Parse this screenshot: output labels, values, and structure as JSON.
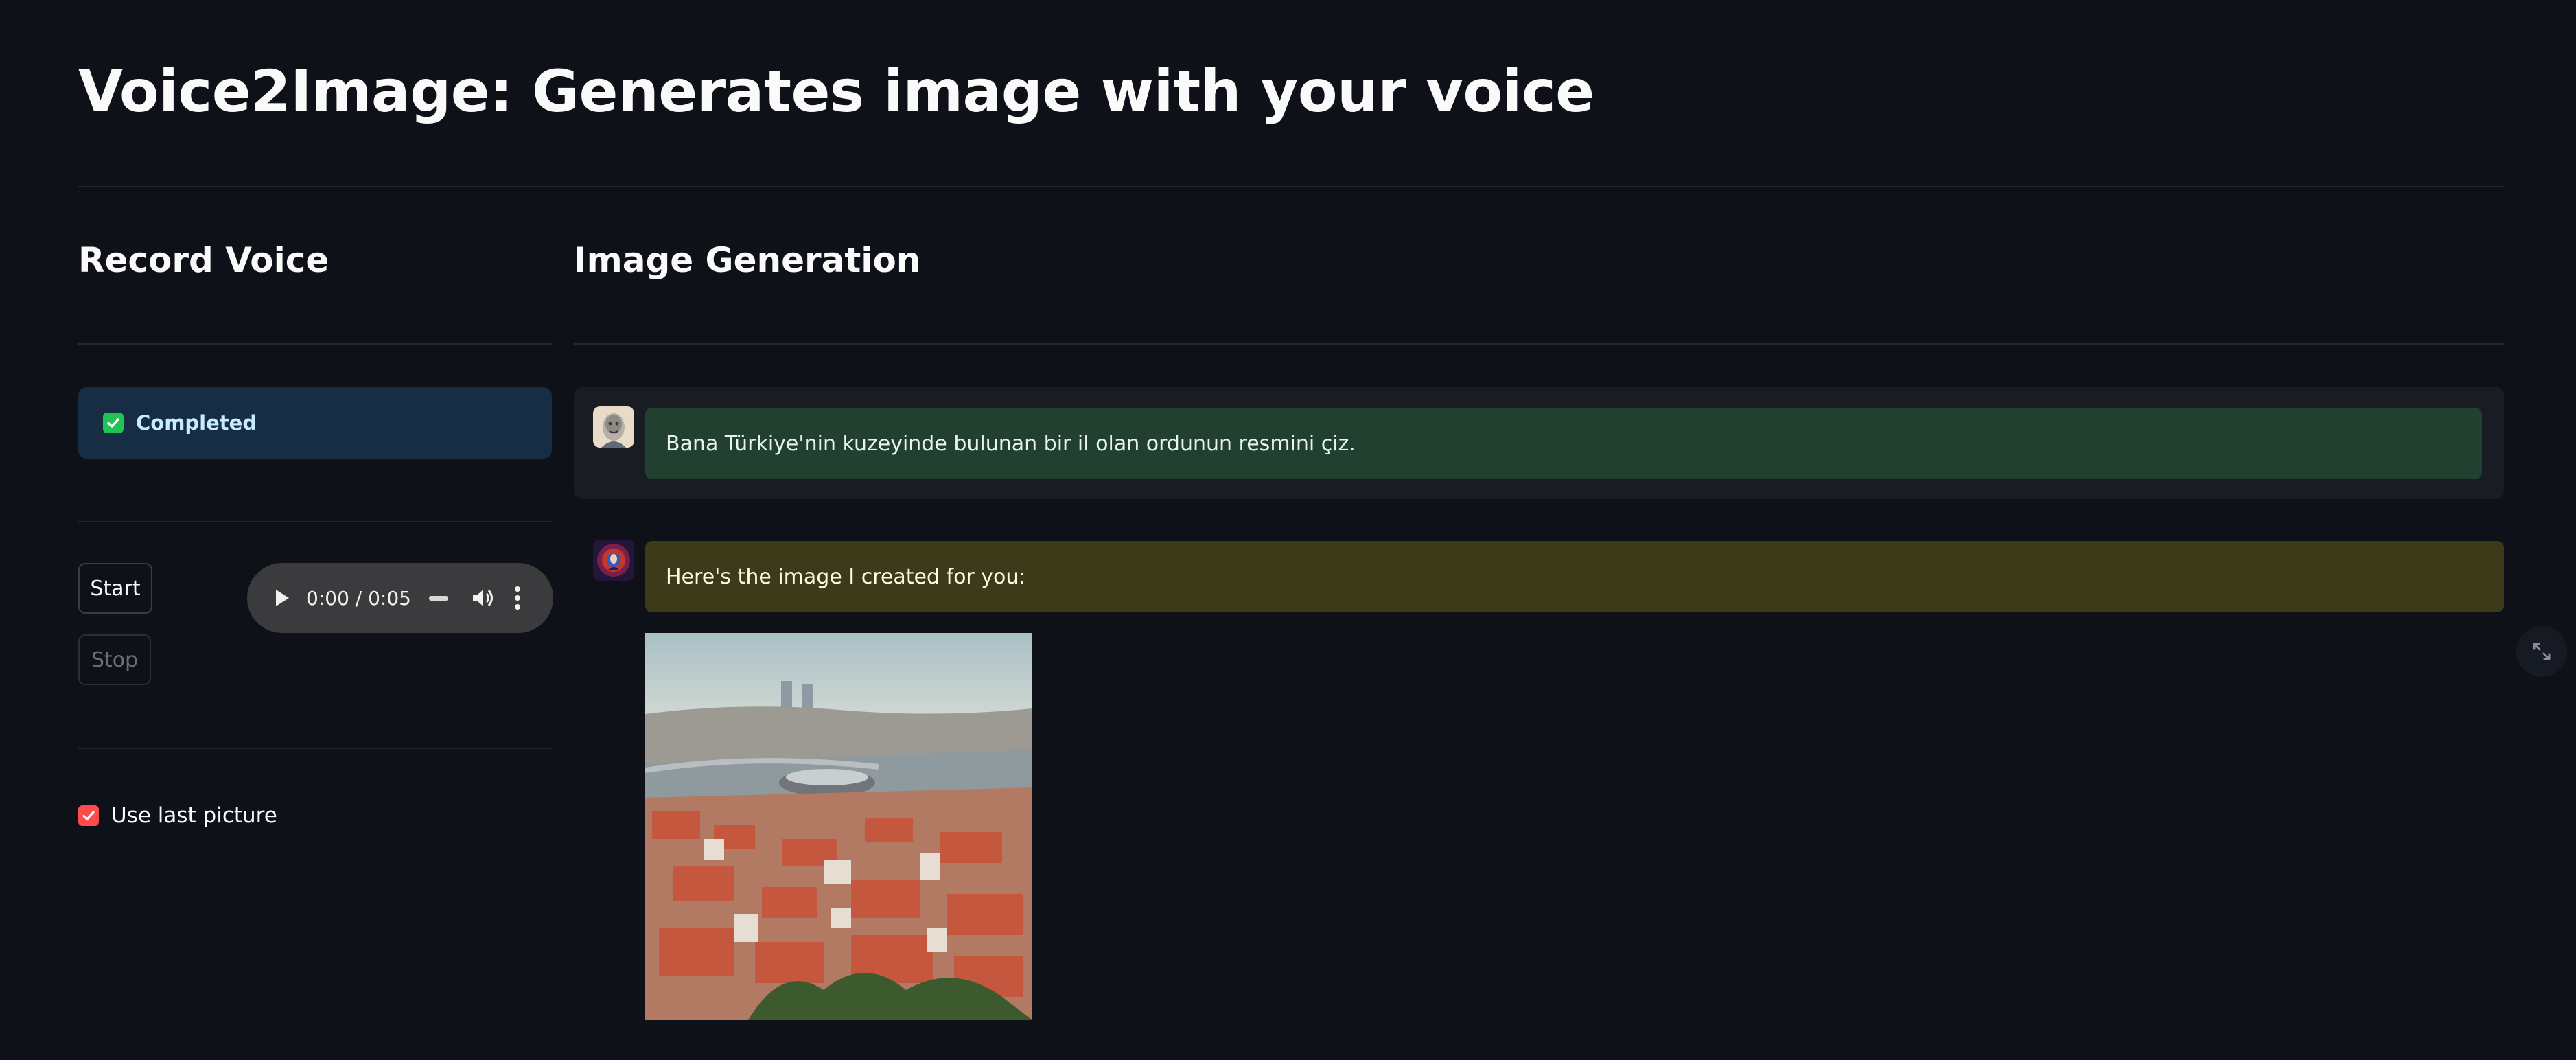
{
  "page": {
    "title": "Voice2Image: Generates image with your voice"
  },
  "left": {
    "heading": "Record Voice",
    "status": {
      "text": "Completed"
    },
    "buttons": {
      "start": "Start",
      "stop": "Stop"
    },
    "audio": {
      "time": "0:00 / 0:05"
    },
    "use_last": {
      "label": "Use last picture",
      "checked": true
    }
  },
  "right": {
    "heading": "Image Generation",
    "messages": [
      {
        "role": "user",
        "text": "Bana Türkiye'nin kuzeyinde bulunan bir il olan ordunun resmini çiz."
      },
      {
        "role": "assistant",
        "text": "Here's the image I created for you:"
      }
    ]
  },
  "colors": {
    "background": "#0e1117",
    "success": "#21c354",
    "checkbox": "#ff4b4b",
    "user_bubble": "#21402f",
    "assistant_bubble": "#3d3a1a"
  },
  "icons": [
    "checkbox-icon",
    "play-icon",
    "volume-icon",
    "more-icon",
    "expand-icon",
    "user-avatar",
    "assistant-avatar"
  ]
}
